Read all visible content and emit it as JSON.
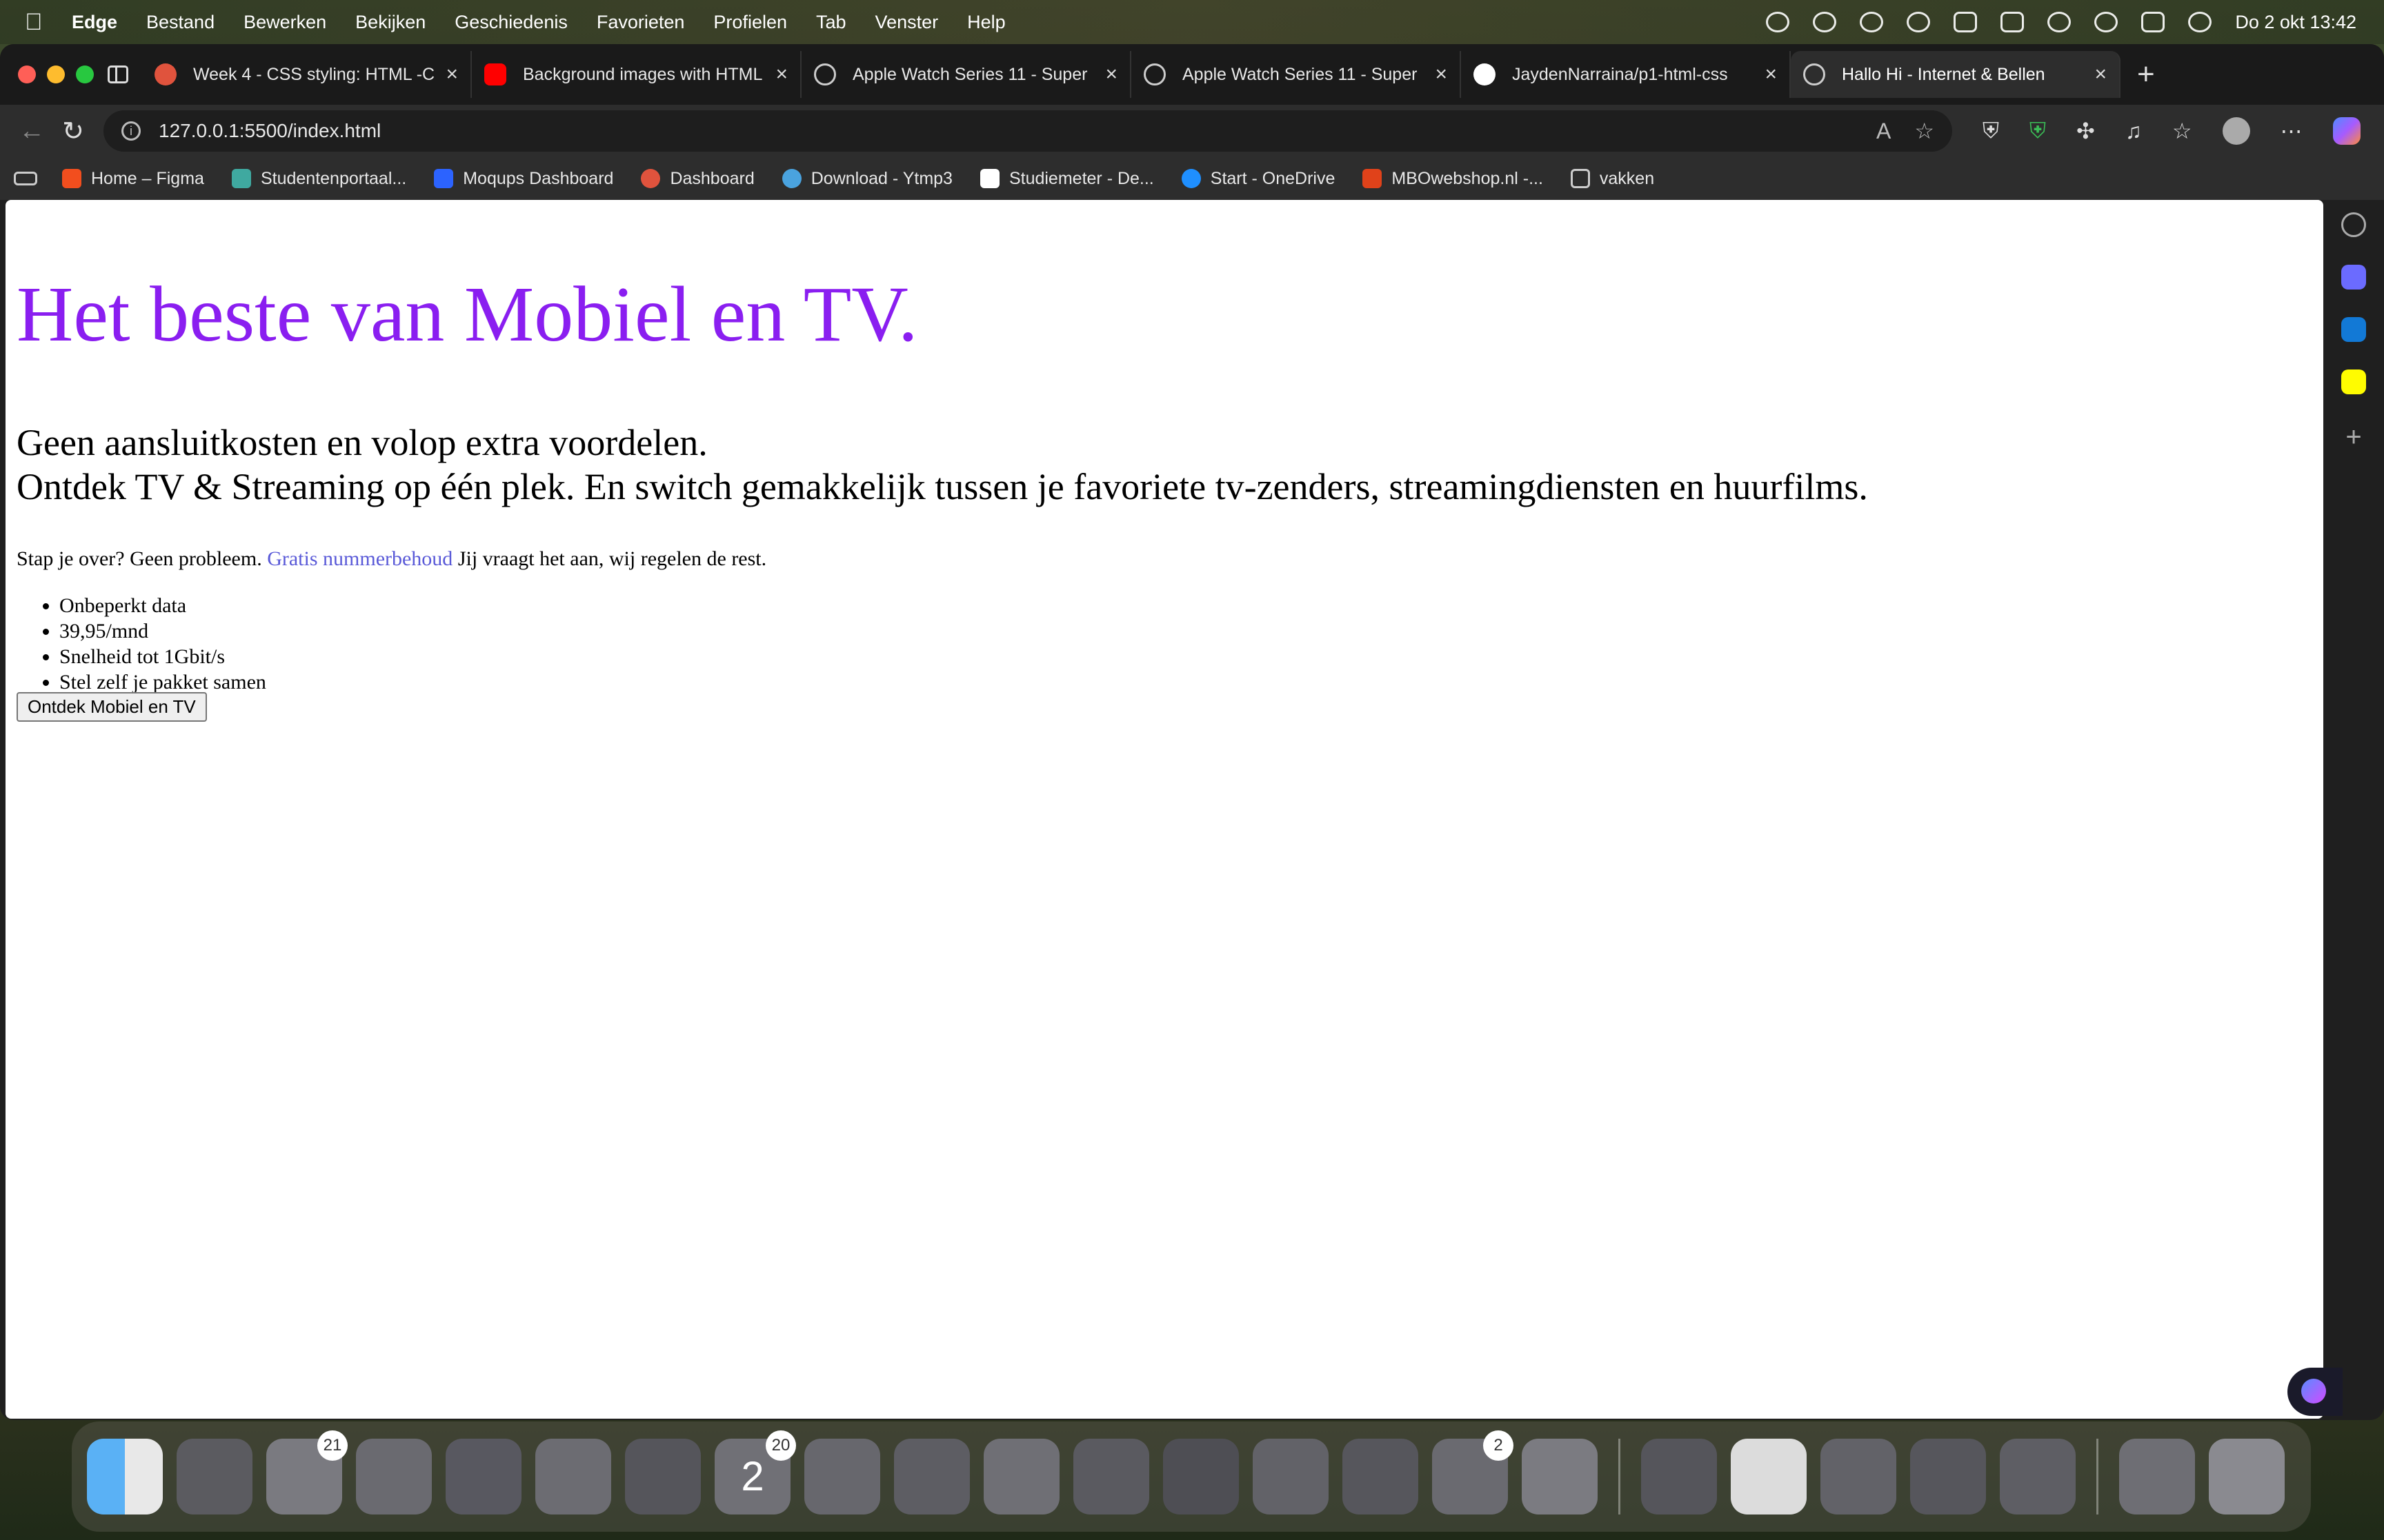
{
  "menubar": {
    "app_name": "Edge",
    "items": [
      "Bestand",
      "Bewerken",
      "Bekijken",
      "Geschiedenis",
      "Favorieten",
      "Profielen",
      "Tab",
      "Venster",
      "Help"
    ],
    "clock": "Do 2 okt  13:42"
  },
  "tabs": [
    {
      "title": "Week 4 - CSS styling: HTML -C",
      "color": "#e0533d"
    },
    {
      "title": "Background images with HTML",
      "color": "#ff0000"
    },
    {
      "title": "Apple Watch Series 11 - Super",
      "color": "#888888"
    },
    {
      "title": "Apple Watch Series 11 - Super",
      "color": "#888888"
    },
    {
      "title": "JaydenNarraina/p1-html-css",
      "color": "#ffffff"
    },
    {
      "title": "Hallo Hi - Internet & Bellen",
      "color": "#888888"
    }
  ],
  "address": {
    "url": "127.0.0.1:5500/index.html"
  },
  "bookmarks": [
    {
      "label": "Home – Figma",
      "color": "#f24e1e"
    },
    {
      "label": "Studentenportaal...",
      "color": "#3fa9a0"
    },
    {
      "label": "Moqups Dashboard",
      "color": "#2c63ff"
    },
    {
      "label": "Dashboard",
      "color": "#e0533d"
    },
    {
      "label": "Download - Ytmp3",
      "color": "#4aa3df"
    },
    {
      "label": "Studiemeter - De...",
      "color": "#ffffff"
    },
    {
      "label": "Start - OneDrive",
      "color": "#1f8fff"
    },
    {
      "label": "MBOwebshop.nl -...",
      "color": "#e0421a"
    },
    {
      "label": "vakken",
      "color": "#cccccc"
    }
  ],
  "page": {
    "heading": "Het beste van Mobiel en TV.",
    "lead_line1": "Geen aansluitkosten en volop extra voordelen.",
    "lead_line2": "Ontdek TV & Streaming op één plek. En switch gemakkelijk tussen je favoriete tv-zenders, streamingdiensten en huurfilms.",
    "intro_before": "Stap je over? Geen probleem.",
    "intro_link": "Gratis nummerbehoud",
    "intro_after": "Jij vraagt het aan, wij regelen de rest.",
    "features": [
      "Onbeperkt data",
      "39,95/mnd",
      "Snelheid tot 1Gbit/s",
      "Stel zelf je pakket samen"
    ],
    "cta_label": "Ontdek Mobiel en TV",
    "heading_color": "#8a1ef0",
    "link_color": "#5a5ad8"
  },
  "dock": {
    "badges": {
      "messages": "21",
      "calendar": "20",
      "settings": "2"
    },
    "calendar_day": "2"
  }
}
